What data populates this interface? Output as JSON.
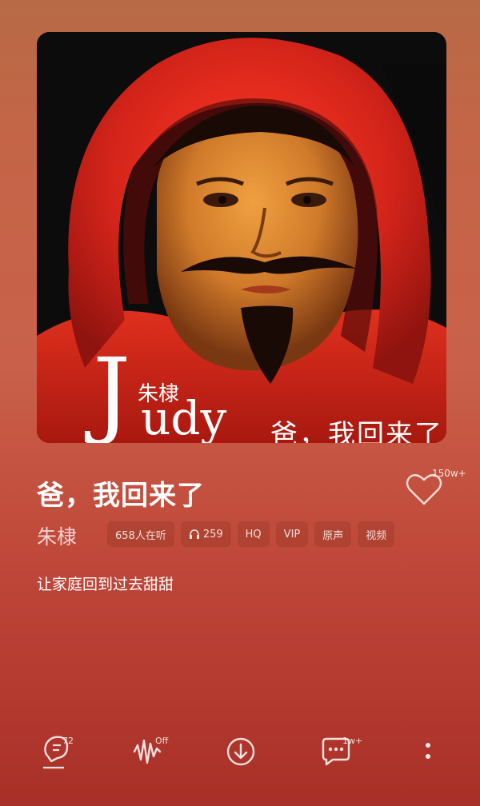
{
  "cover": {
    "brand_big": "J",
    "brand_rest": "udy",
    "brand_small": "朱棣",
    "subtitle": "爸，我回来了"
  },
  "song": {
    "title": "爸，我回来了",
    "artist": "朱棣",
    "like_count": "150w+",
    "lyric": "让家庭回到过去甜甜"
  },
  "tags": {
    "listeners": "658人在听",
    "headphones": "259",
    "hq": "HQ",
    "vip": "VIP",
    "original": "原声",
    "video": "视频"
  },
  "toolbar": {
    "comment_badge": "72",
    "effect_badge": "Off",
    "message_badge": "1w+"
  },
  "colors": {
    "background_top": "#b86a46",
    "background_bottom": "#a83028",
    "hood_red": "#d42a1c"
  }
}
